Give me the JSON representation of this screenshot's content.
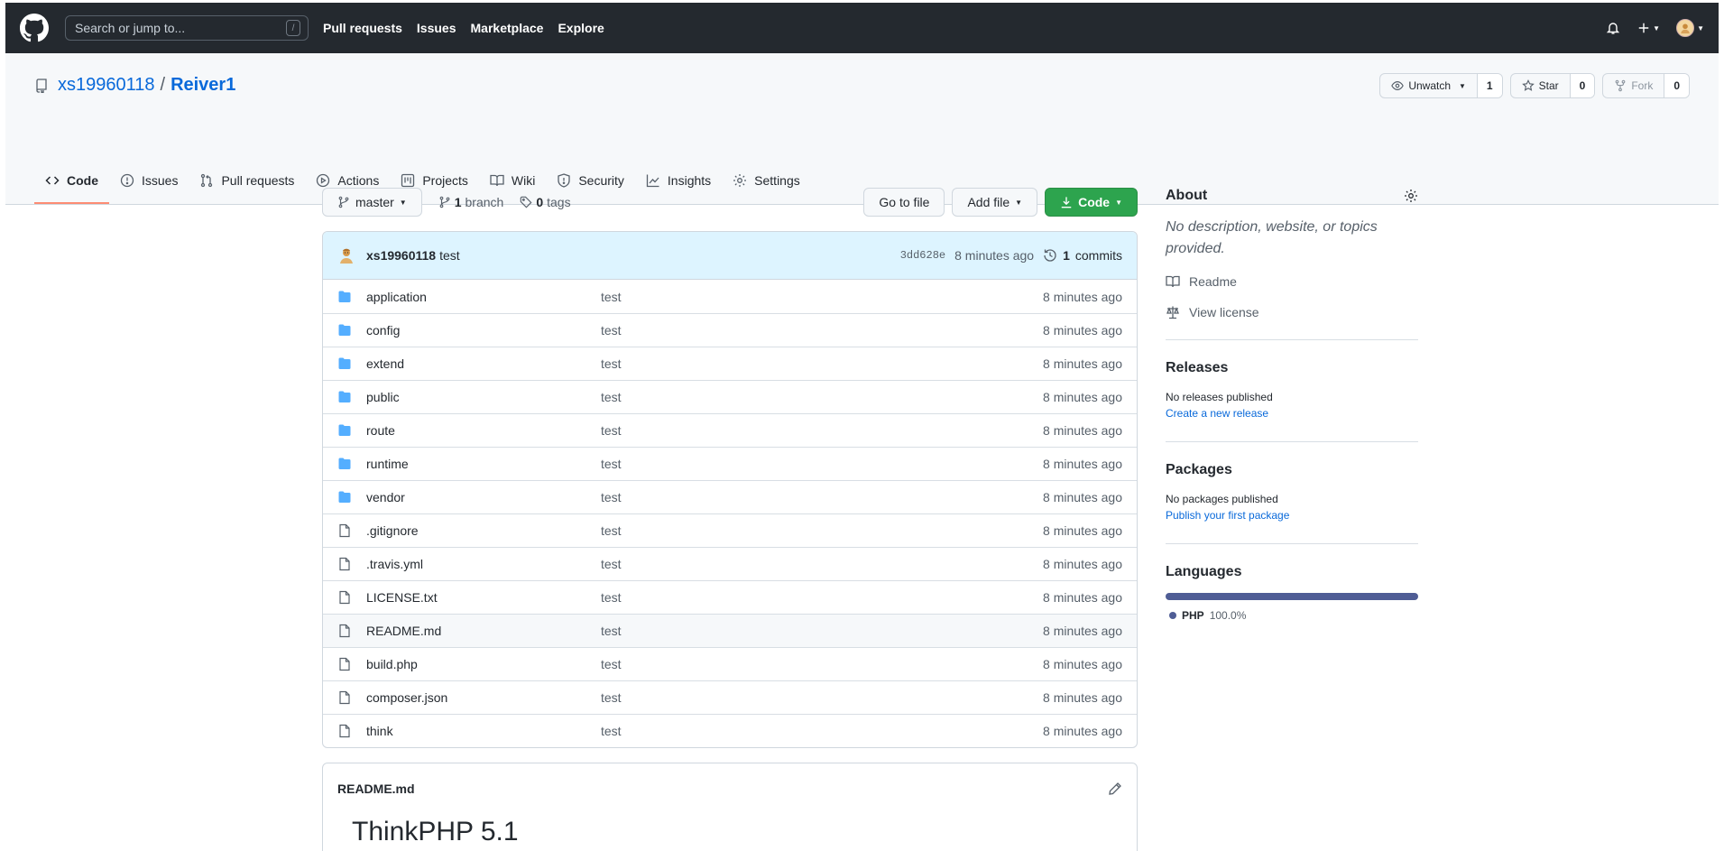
{
  "topbar": {
    "search_placeholder": "Search or jump to...",
    "search_shortcut": "/",
    "nav": [
      "Pull requests",
      "Issues",
      "Marketplace",
      "Explore"
    ]
  },
  "repo": {
    "owner": "xs19960118",
    "separator": "/",
    "name": "Reiver1",
    "watch": {
      "label": "Unwatch",
      "count": "1"
    },
    "star": {
      "label": "Star",
      "count": "0"
    },
    "fork": {
      "label": "Fork",
      "count": "0"
    }
  },
  "tabs": [
    "Code",
    "Issues",
    "Pull requests",
    "Actions",
    "Projects",
    "Wiki",
    "Security",
    "Insights",
    "Settings"
  ],
  "filebar": {
    "branch": "master",
    "branch_count": "1",
    "branch_label": "branch",
    "tags_count": "0",
    "tags_label": "tags",
    "go_to_file": "Go to file",
    "add_file": "Add file",
    "code": "Code"
  },
  "commit": {
    "author": "xs19960118",
    "message": "test",
    "sha": "3dd628e",
    "time": "8 minutes ago",
    "commits_count": "1",
    "commits_label": "commits"
  },
  "files": [
    {
      "name": "application",
      "type": "dir",
      "msg": "test",
      "age": "8 minutes ago"
    },
    {
      "name": "config",
      "type": "dir",
      "msg": "test",
      "age": "8 minutes ago"
    },
    {
      "name": "extend",
      "type": "dir",
      "msg": "test",
      "age": "8 minutes ago"
    },
    {
      "name": "public",
      "type": "dir",
      "msg": "test",
      "age": "8 minutes ago"
    },
    {
      "name": "route",
      "type": "dir",
      "msg": "test",
      "age": "8 minutes ago"
    },
    {
      "name": "runtime",
      "type": "dir",
      "msg": "test",
      "age": "8 minutes ago"
    },
    {
      "name": "vendor",
      "type": "dir",
      "msg": "test",
      "age": "8 minutes ago"
    },
    {
      "name": ".gitignore",
      "type": "file",
      "msg": "test",
      "age": "8 minutes ago"
    },
    {
      "name": ".travis.yml",
      "type": "file",
      "msg": "test",
      "age": "8 minutes ago"
    },
    {
      "name": "LICENSE.txt",
      "type": "file",
      "msg": "test",
      "age": "8 minutes ago"
    },
    {
      "name": "README.md",
      "type": "file",
      "msg": "test",
      "age": "8 minutes ago"
    },
    {
      "name": "build.php",
      "type": "file",
      "msg": "test",
      "age": "8 minutes ago"
    },
    {
      "name": "composer.json",
      "type": "file",
      "msg": "test",
      "age": "8 minutes ago"
    },
    {
      "name": "think",
      "type": "file",
      "msg": "test",
      "age": "8 minutes ago"
    }
  ],
  "readme": {
    "filename": "README.md",
    "heading": "ThinkPHP 5.1"
  },
  "sidebar": {
    "about_title": "About",
    "about_desc": "No description, website, or topics provided.",
    "readme_link": "Readme",
    "license_link": "View license",
    "releases_title": "Releases",
    "releases_text": "No releases published",
    "releases_link": "Create a new release",
    "packages_title": "Packages",
    "packages_text": "No packages published",
    "packages_link": "Publish your first package",
    "languages_title": "Languages",
    "language_name": "PHP",
    "language_pct": "100.0%",
    "language_share": 1.0,
    "language_color": "#4f5d95"
  },
  "colors": {
    "header_bg": "#24292f",
    "link": "#0969da",
    "green_button": "#2da44e",
    "commit_row_bg": "#ddf4ff",
    "active_tab_underline": "#fd8c73",
    "folder": "#54aeff"
  }
}
